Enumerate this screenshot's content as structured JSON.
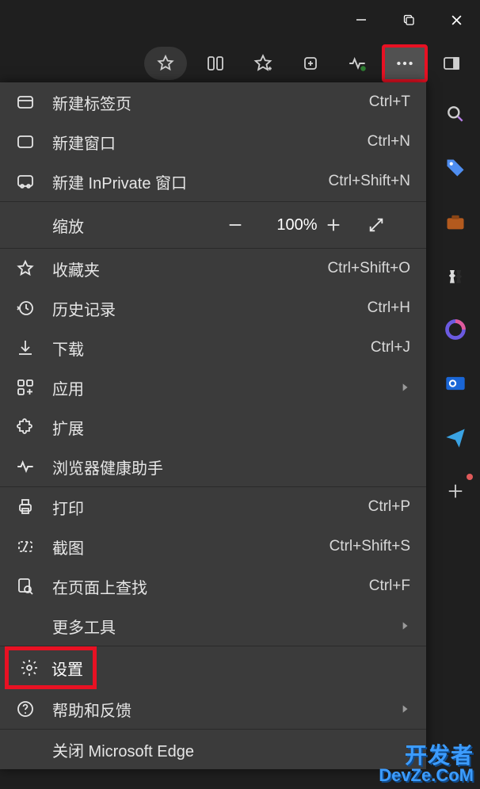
{
  "window": {
    "minimize": "min",
    "maximize": "max",
    "close": "close"
  },
  "toolbar": {
    "favorite": "star",
    "split": "split",
    "favorites": "star-plus",
    "collections": "collection",
    "health": "heartbeat",
    "more": "more",
    "side": "sidepanel"
  },
  "zoom": {
    "label": "缩放",
    "value": "100%"
  },
  "menu": {
    "new_tab": {
      "label": "新建标签页",
      "shortcut": "Ctrl+T"
    },
    "new_window": {
      "label": "新建窗口",
      "shortcut": "Ctrl+N"
    },
    "new_inprivate": {
      "label": "新建 InPrivate 窗口",
      "shortcut": "Ctrl+Shift+N"
    },
    "favorites": {
      "label": "收藏夹",
      "shortcut": "Ctrl+Shift+O"
    },
    "history": {
      "label": "历史记录",
      "shortcut": "Ctrl+H"
    },
    "downloads": {
      "label": "下载",
      "shortcut": "Ctrl+J"
    },
    "apps": {
      "label": "应用"
    },
    "extensions": {
      "label": "扩展"
    },
    "health": {
      "label": "浏览器健康助手"
    },
    "print": {
      "label": "打印",
      "shortcut": "Ctrl+P"
    },
    "screenshot": {
      "label": "截图",
      "shortcut": "Ctrl+Shift+S"
    },
    "find": {
      "label": "在页面上查找",
      "shortcut": "Ctrl+F"
    },
    "more_tools": {
      "label": "更多工具"
    },
    "settings": {
      "label": "设置"
    },
    "help": {
      "label": "帮助和反馈"
    },
    "close_edge": {
      "label": "关闭 Microsoft Edge"
    }
  },
  "sidebar": {
    "search": "search",
    "tag": "tag",
    "work": "briefcase",
    "games": "chess",
    "m365": "m365",
    "outlook": "outlook",
    "send": "send",
    "add": "plus"
  },
  "watermark": {
    "line1": "开发者",
    "line2": "DevZe.CoM"
  }
}
